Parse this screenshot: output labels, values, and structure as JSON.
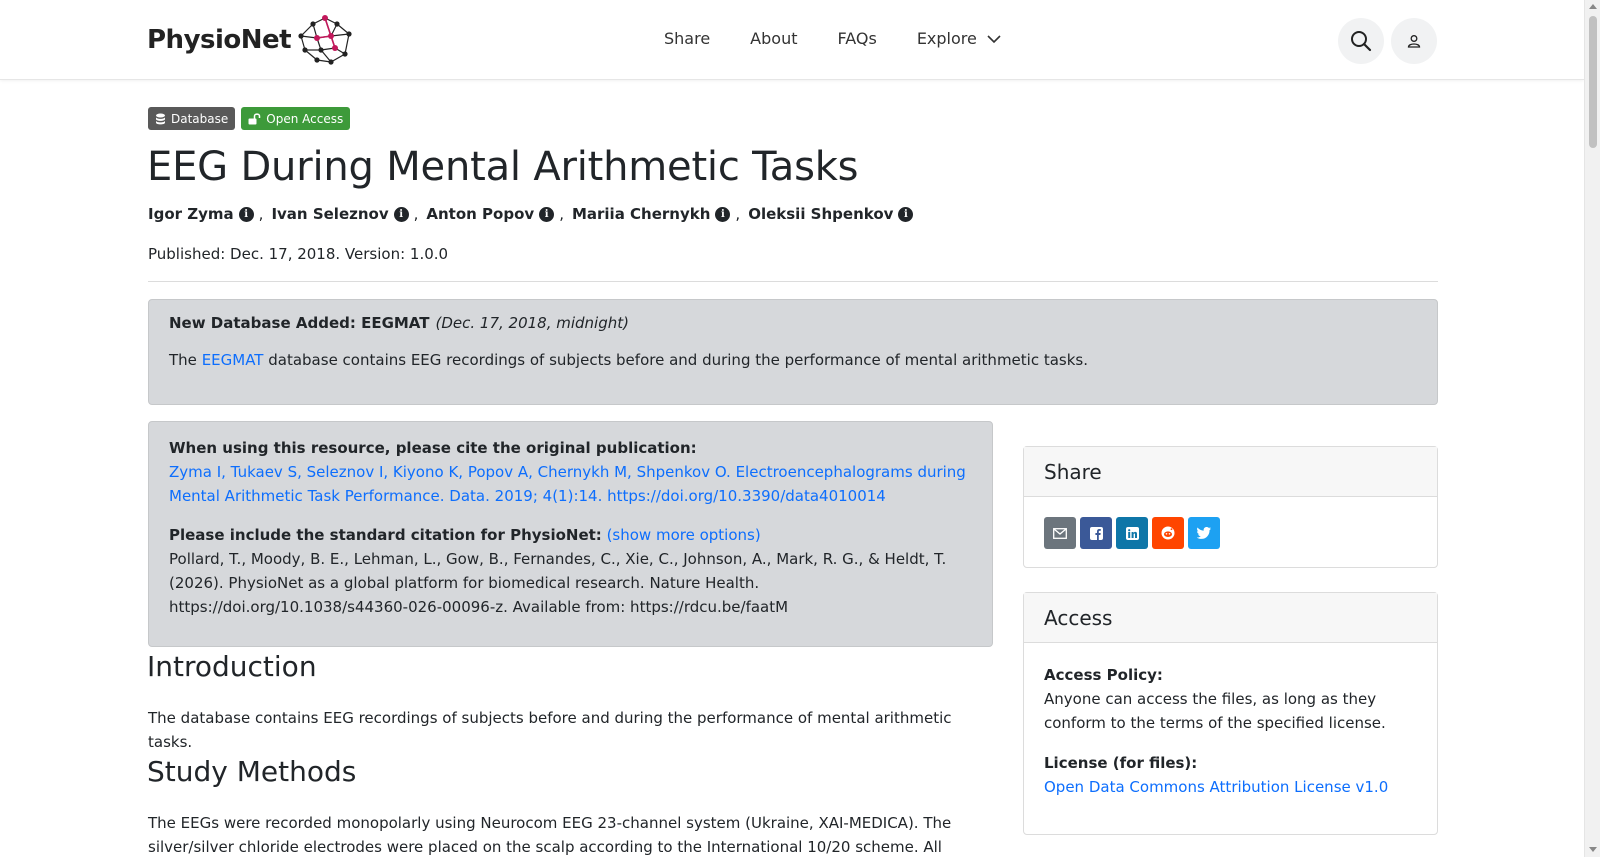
{
  "header": {
    "brand": "PhysioNet",
    "nav": [
      {
        "label": "Share"
      },
      {
        "label": "About"
      },
      {
        "label": "FAQs"
      },
      {
        "label": "Explore"
      }
    ]
  },
  "badges": {
    "database": "Database",
    "open_access": "Open Access"
  },
  "project": {
    "title": "EEG During Mental Arithmetic Tasks",
    "authors": [
      "Igor Zyma",
      "Ivan Seleznov",
      "Anton Popov",
      "Mariia Chernykh",
      "Oleksii Shpenkov"
    ],
    "author_separator": ",",
    "published": "Published: Dec. 17, 2018. Version: 1.0.0"
  },
  "announcement": {
    "heading": "New Database Added: EEGMAT",
    "date": "(Dec. 17, 2018, midnight)",
    "body_prefix": "The",
    "link": "EEGMAT",
    "body_suffix": "database contains EEG recordings of subjects before and during the performance of mental arithmetic tasks."
  },
  "citation": {
    "original_label": "When using this resource, please cite the original publication:",
    "original_text": "Zyma I, Tukaev S, Seleznov I, Kiyono K, Popov A, Chernykh M, Shpenkov O. Electroencephalograms during Mental Arithmetic Task Performance. Data. 2019; 4(1):14. https://doi.org/10.3390/data4010014",
    "standard_label": "Please include the standard citation for PhysioNet:",
    "more_options": "(show more options)",
    "standard_text": "Pollard, T., Moody, B. E., Lehman, L., Gow, B., Fernandes, C., Xie, C., Johnson, A., Mark, R. G., & Heldt, T. (2026). PhysioNet as a global platform for biomedical research. Nature Health. https://doi.org/10.1038/s44360-026-00096-z. Available from: https://rdcu.be/faatM"
  },
  "sections": {
    "intro_heading": "Introduction",
    "intro_text": "The database contains EEG recordings of subjects before and during the performance of mental arithmetic tasks.",
    "methods_heading": "Study Methods",
    "methods_text": "The EEGs were recorded monopolarly using Neurocom EEG 23-channel system (Ukraine, XAI-MEDICA). The silver/silver chloride electrodes were placed on the scalp according to the International 10/20 scheme. All"
  },
  "share_card": {
    "title": "Share",
    "buttons": [
      {
        "icon": "email-icon",
        "color": "#6c757d"
      },
      {
        "icon": "facebook-icon",
        "color": "#3b5998"
      },
      {
        "icon": "linkedin-icon",
        "color": "#0e76a8"
      },
      {
        "icon": "reddit-icon",
        "color": "#ff4500"
      },
      {
        "icon": "twitter-icon",
        "color": "#1da1f2"
      }
    ]
  },
  "access_card": {
    "title": "Access",
    "policy_label": "Access Policy:",
    "policy_text": "Anyone can access the files, as long as they conform to the terms of the specified license.",
    "license_label": "License (for files):",
    "license_link": "Open Data Commons Attribution License v1.0"
  },
  "colors": {
    "link": "#0d6efd",
    "badge_database": "#595959",
    "badge_open_access": "#3d9a3a",
    "alert_bg": "#d6d8db"
  }
}
